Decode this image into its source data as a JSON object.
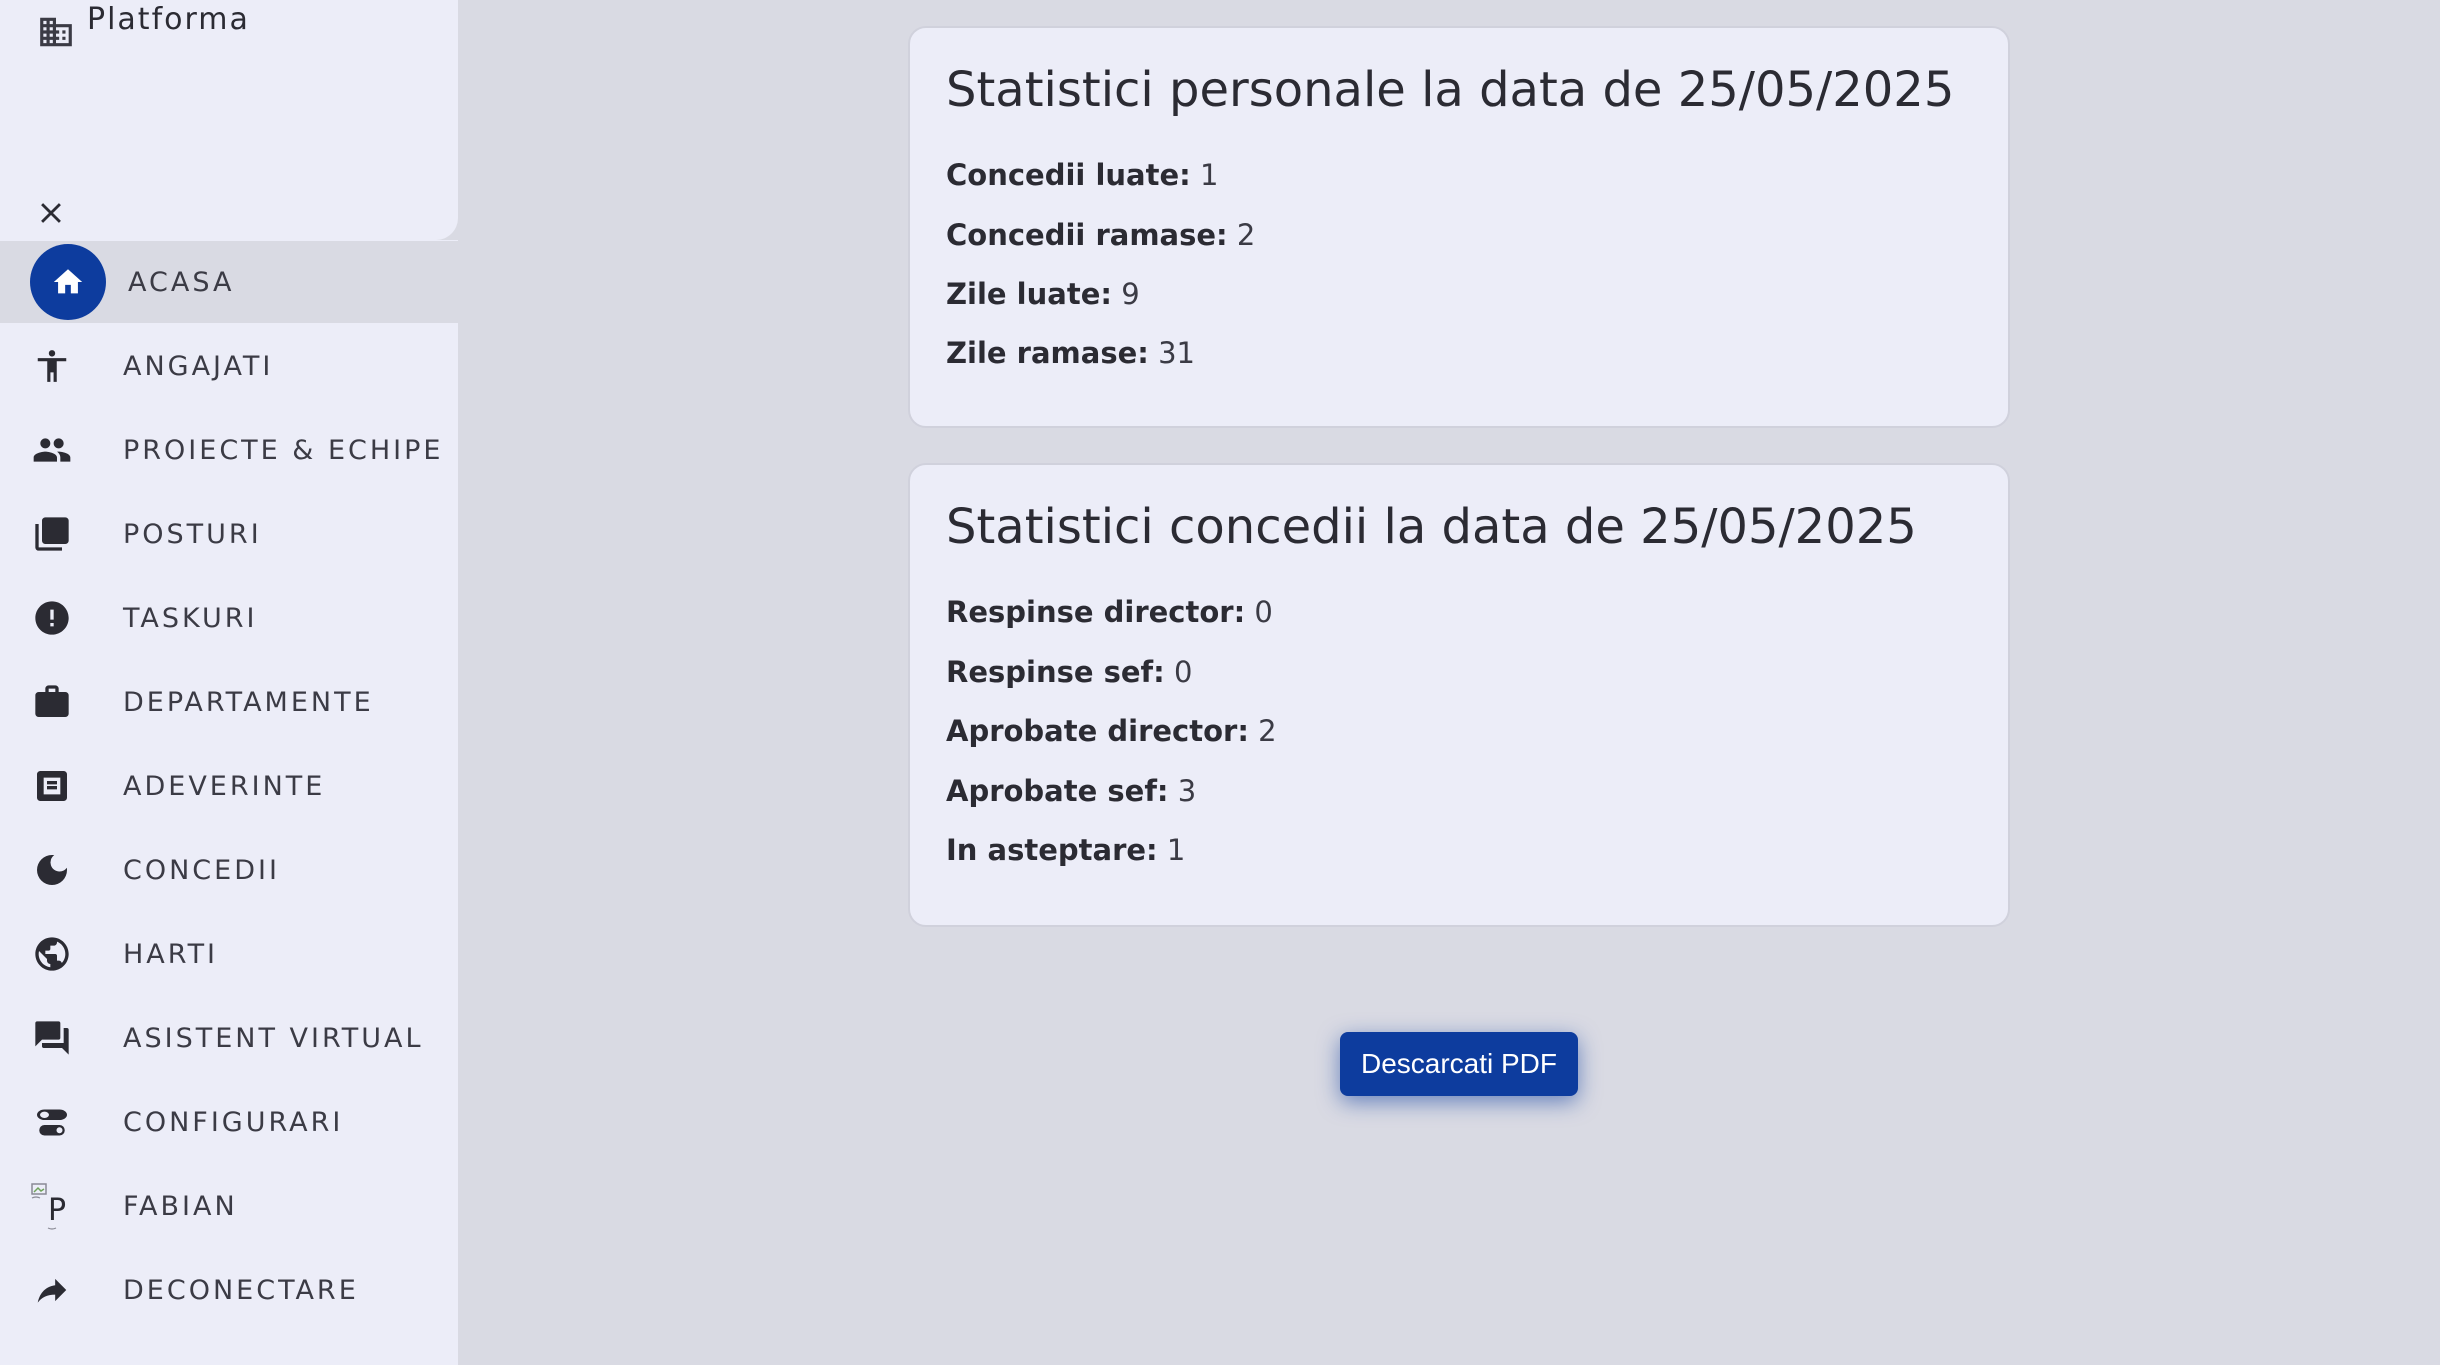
{
  "brand": {
    "name": "Platforma",
    "icon": "building-icon"
  },
  "sidebar": {
    "close_icon": "close-icon",
    "items": [
      {
        "label": "ACASA",
        "icon": "home-icon",
        "active": true
      },
      {
        "label": "ANGAJATI",
        "icon": "person-icon"
      },
      {
        "label": "PROIECTE & ECHIPE",
        "icon": "people-icon"
      },
      {
        "label": "POSTURI",
        "icon": "copy-icon"
      },
      {
        "label": "TASKURI",
        "icon": "alert-circle-icon"
      },
      {
        "label": "DEPARTAMENTE",
        "icon": "briefcase-icon"
      },
      {
        "label": "ADEVERINTE",
        "icon": "document-icon"
      },
      {
        "label": "CONCEDII",
        "icon": "moon-icon"
      },
      {
        "label": "HARTI",
        "icon": "globe-icon"
      },
      {
        "label": "ASISTENT VIRTUAL",
        "icon": "chat-icon"
      },
      {
        "label": "CONFIGURARI",
        "icon": "toggles-icon"
      },
      {
        "label": "FABIAN",
        "icon": "avatar-broken-image"
      },
      {
        "label": "DECONECTARE",
        "icon": "logout-arrow-icon"
      }
    ]
  },
  "personal_stats": {
    "title": "Statistici personale la data de 25/05/2025",
    "rows": [
      {
        "label": "Concedii luate:",
        "value": "1"
      },
      {
        "label": "Concedii ramase:",
        "value": "2"
      },
      {
        "label": "Zile luate:",
        "value": "9"
      },
      {
        "label": "Zile ramase:",
        "value": "31"
      }
    ]
  },
  "leave_stats": {
    "title": "Statistici concedii la data de 25/05/2025",
    "rows": [
      {
        "label": "Respinse director:",
        "value": "0"
      },
      {
        "label": "Respinse sef:",
        "value": "0"
      },
      {
        "label": "Aprobate director:",
        "value": "2"
      },
      {
        "label": "Aprobate sef:",
        "value": "3"
      },
      {
        "label": "In asteptare:",
        "value": "1"
      }
    ]
  },
  "actions": {
    "download_pdf": "Descarcati PDF"
  },
  "colors": {
    "accent": "#0d3c9e",
    "sidebar_bg": "#ecedf8",
    "page_bg": "#d9dae3"
  }
}
